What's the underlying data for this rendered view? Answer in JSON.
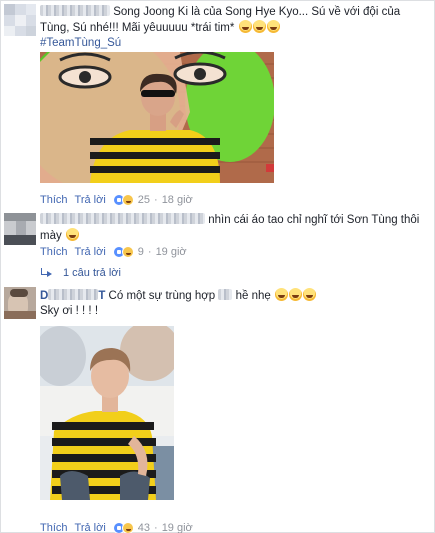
{
  "comments": [
    {
      "text": "Song Joong Ki là của Song Hye Kyo... Sú về với đội của Tùng, Sú nhé!!! Mãi yêuuuuu *trái tim*",
      "tag": "#TeamTùng_Sú",
      "actions": {
        "like": "Thích",
        "reply": "Trả lời"
      },
      "reaction_count": "25",
      "time": "18 giờ"
    },
    {
      "text": "nhìn cái áo tao chỉ nghĩ tới Sơn Tùng thôi mày",
      "actions": {
        "like": "Thích",
        "reply": "Trả lời"
      },
      "reaction_count": "9",
      "time": "19 giờ",
      "replies_link": "1 câu trả lời"
    },
    {
      "name_prefix": "D",
      "name_suffix": "T",
      "text": "Có một sự trùng hợp",
      "text_tail": "hề nhẹ",
      "line2": "Sky ơi ! ! ! !",
      "actions": {
        "like": "Thích",
        "reply": "Trả lời"
      },
      "reaction_count": "43",
      "time": "19 giờ"
    }
  ],
  "separator": "·",
  "colors": {
    "link": "#365899",
    "action": "#4267b2",
    "meta": "#90949c",
    "stripe_yellow": "#f2cf1a",
    "stripe_black": "#1b1b1b",
    "graffiti_green": "#5cc62a",
    "brick": "#b06a4a"
  },
  "icons": [
    "avatar",
    "like-reaction-icon",
    "haha-reaction-icon",
    "laugh-emoji-icon",
    "reply-arrow-icon"
  ]
}
